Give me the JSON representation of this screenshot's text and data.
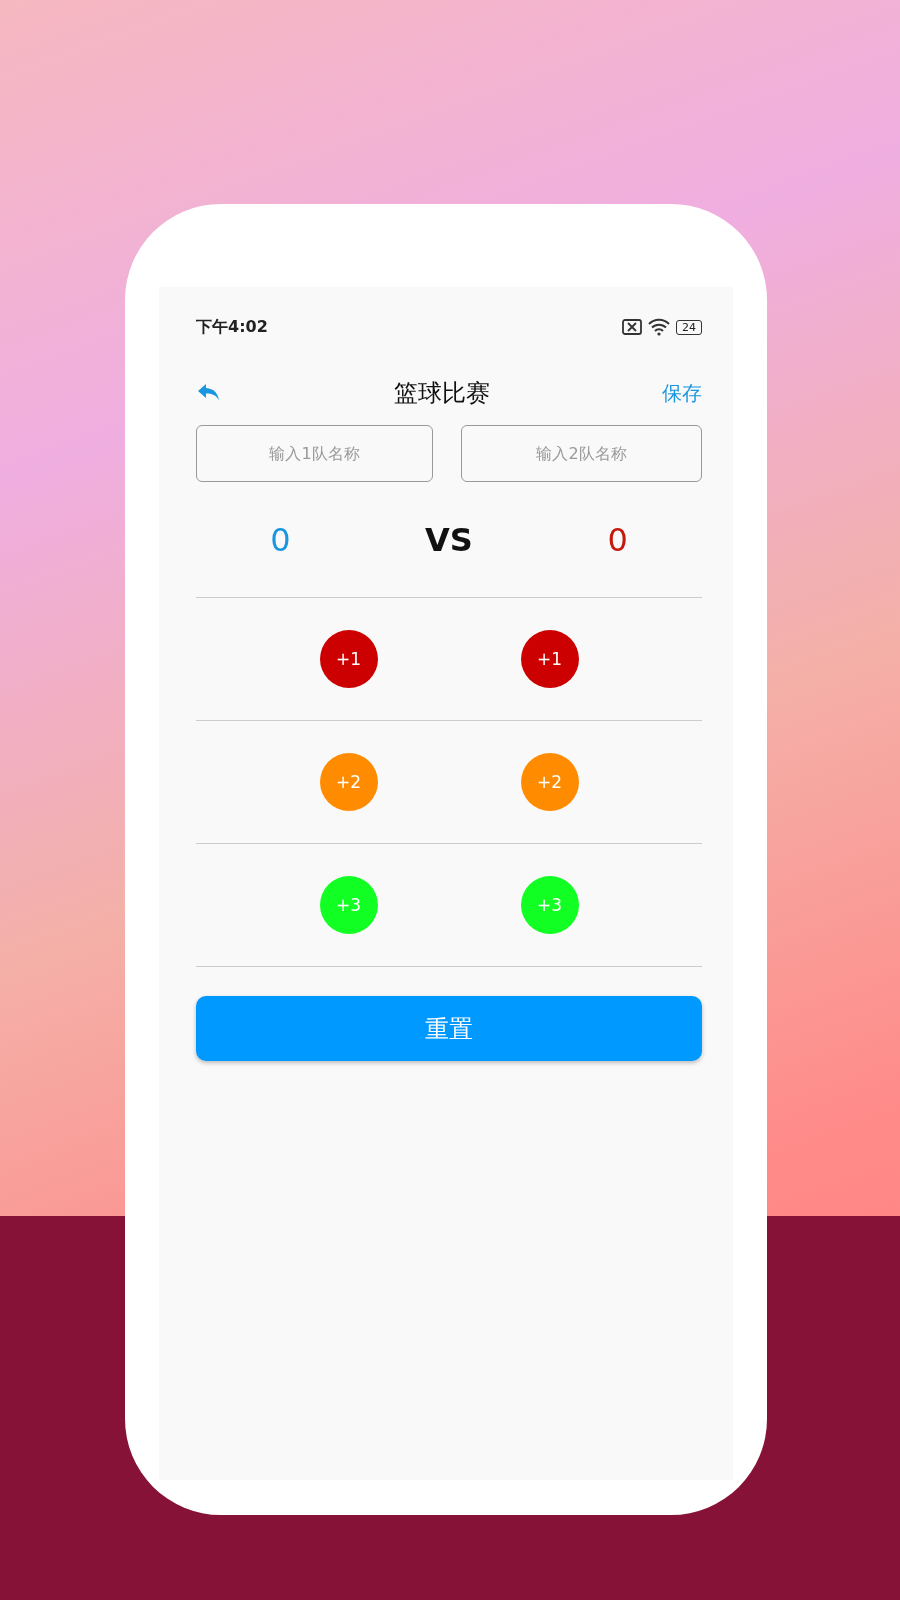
{
  "status_bar": {
    "time": "下午4:02",
    "battery": "24"
  },
  "header": {
    "title": "篮球比赛",
    "action": "保存"
  },
  "teams": [
    {
      "placeholder": "输入1队名称",
      "score": "0",
      "color": "#1a96e0"
    },
    {
      "placeholder": "输入2队名称",
      "score": "0",
      "color": "#c41a0e"
    }
  ],
  "versus": "VS",
  "score_rows": [
    {
      "buttons": [
        {
          "label": "+1",
          "color": "#cc0000"
        },
        {
          "label": "+1",
          "color": "#cc0000"
        }
      ]
    },
    {
      "buttons": [
        {
          "label": "+2",
          "color": "#ff8c00"
        },
        {
          "label": "+2",
          "color": "#ff8c00"
        }
      ]
    },
    {
      "buttons": [
        {
          "label": "+3",
          "color": "#11ff22"
        },
        {
          "label": "+3",
          "color": "#11ff22"
        }
      ]
    }
  ],
  "reset_button": "重置"
}
